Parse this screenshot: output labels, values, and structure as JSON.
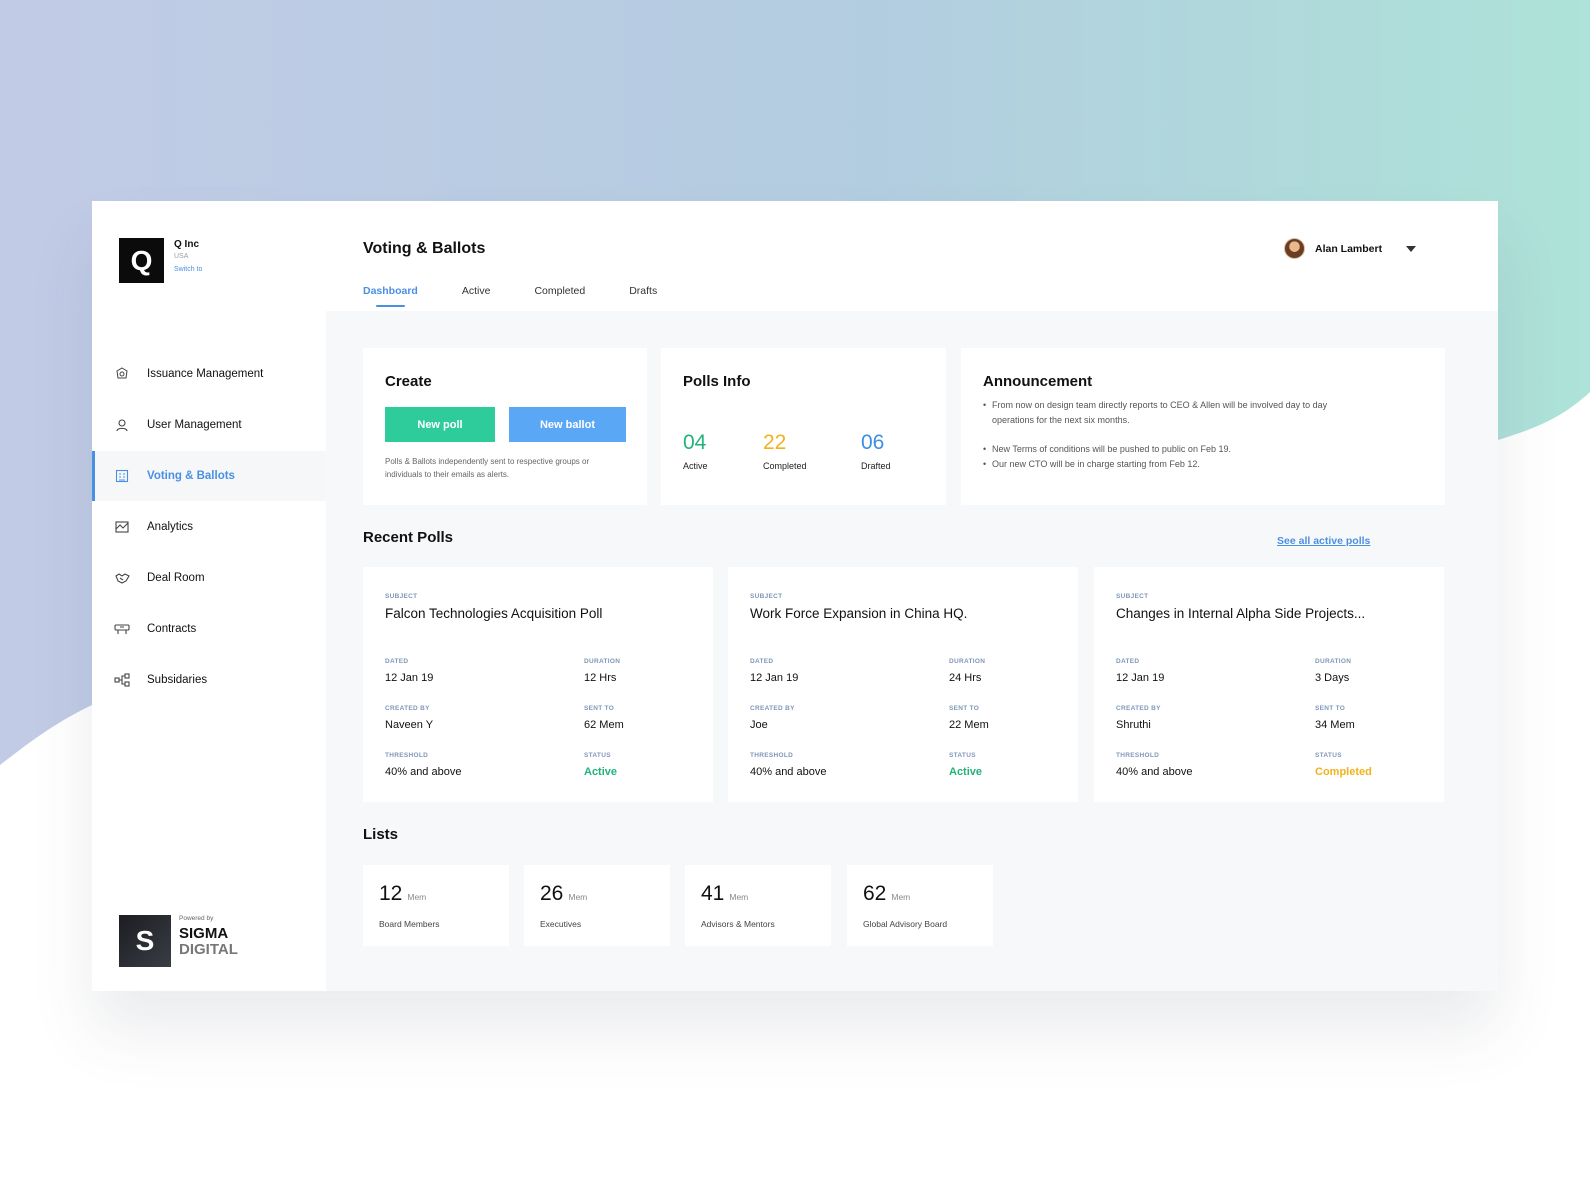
{
  "org": {
    "logo_letter": "Q",
    "name": "Q Inc",
    "country": "USA",
    "switch_label": "Switch to"
  },
  "sidebar": {
    "items": [
      {
        "label": "Issuance Management",
        "icon": "coins-icon"
      },
      {
        "label": "User Management",
        "icon": "user-icon"
      },
      {
        "label": "Voting & Ballots",
        "icon": "ballot-icon",
        "active": true
      },
      {
        "label": "Analytics",
        "icon": "chart-icon"
      },
      {
        "label": "Deal Room",
        "icon": "handshake-icon"
      },
      {
        "label": "Contracts",
        "icon": "contract-icon"
      },
      {
        "label": "Subsidaries",
        "icon": "hierarchy-icon"
      }
    ]
  },
  "powered": {
    "small": "Powered by",
    "letter": "S",
    "line1": "SIGMA",
    "line2": "DIGITAL"
  },
  "header": {
    "title": "Voting & Ballots",
    "user_name": "Alan Lambert",
    "tabs": [
      "Dashboard",
      "Active",
      "Completed",
      "Drafts"
    ]
  },
  "create": {
    "title": "Create",
    "new_poll": "New poll",
    "new_ballot": "New ballot",
    "description": "Polls & Ballots independently sent to respective groups or individuals to their emails as alerts."
  },
  "polls_info": {
    "title": "Polls Info",
    "stats": [
      {
        "value": "04",
        "label": "Active",
        "color": "#22b27a"
      },
      {
        "value": "22",
        "label": "Completed",
        "color": "#f2b21d"
      },
      {
        "value": "06",
        "label": "Drafted",
        "color": "#3b8fe6"
      }
    ]
  },
  "announcement": {
    "title": "Announcement",
    "items": [
      "From now on design team directly reports to CEO & Allen will be involved day to day operations for the next six months.",
      "New Terms of conditions will be pushed to public on Feb 19.",
      "Our new CTO will be in charge starting from Feb 12."
    ]
  },
  "recent_polls": {
    "title": "Recent Polls",
    "see_all": "See all active polls",
    "labels": {
      "subject": "SUBJECT",
      "dated": "DATED",
      "duration": "DURATION",
      "created_by": "CREATED BY",
      "sent_to": "SENT TO",
      "threshold": "THRESHOLD",
      "status": "STATUS"
    },
    "items": [
      {
        "subject": "Falcon Technologies Acquisition Poll",
        "dated": "12 Jan 19",
        "duration": "12 Hrs",
        "created_by": "Naveen Y",
        "sent_to": "62 Mem",
        "threshold": "40% and above",
        "status": "Active"
      },
      {
        "subject": "Work Force Expansion in China HQ.",
        "dated": "12 Jan 19",
        "duration": "24 Hrs",
        "created_by": "Joe",
        "sent_to": "22 Mem",
        "threshold": "40% and above",
        "status": "Active"
      },
      {
        "subject": "Changes in Internal Alpha Side Projects...",
        "dated": "12 Jan 19",
        "duration": "3 Days",
        "created_by": "Shruthi",
        "sent_to": "34 Mem",
        "threshold": "40% and above",
        "status": "Completed"
      }
    ]
  },
  "lists": {
    "title": "Lists",
    "items": [
      {
        "count": "12",
        "unit": "Mem",
        "label": "Board Members"
      },
      {
        "count": "26",
        "unit": "Mem",
        "label": "Executives"
      },
      {
        "count": "41",
        "unit": "Mem",
        "label": "Advisors & Mentors"
      },
      {
        "count": "62",
        "unit": "Mem",
        "label": "Global Advisory Board"
      }
    ]
  },
  "colors": {
    "accent": "#4a90e2",
    "active": "#22b27a",
    "completed": "#f2b21d",
    "poll_button": "#2ecc9a",
    "ballot_button": "#5aa8f5"
  }
}
